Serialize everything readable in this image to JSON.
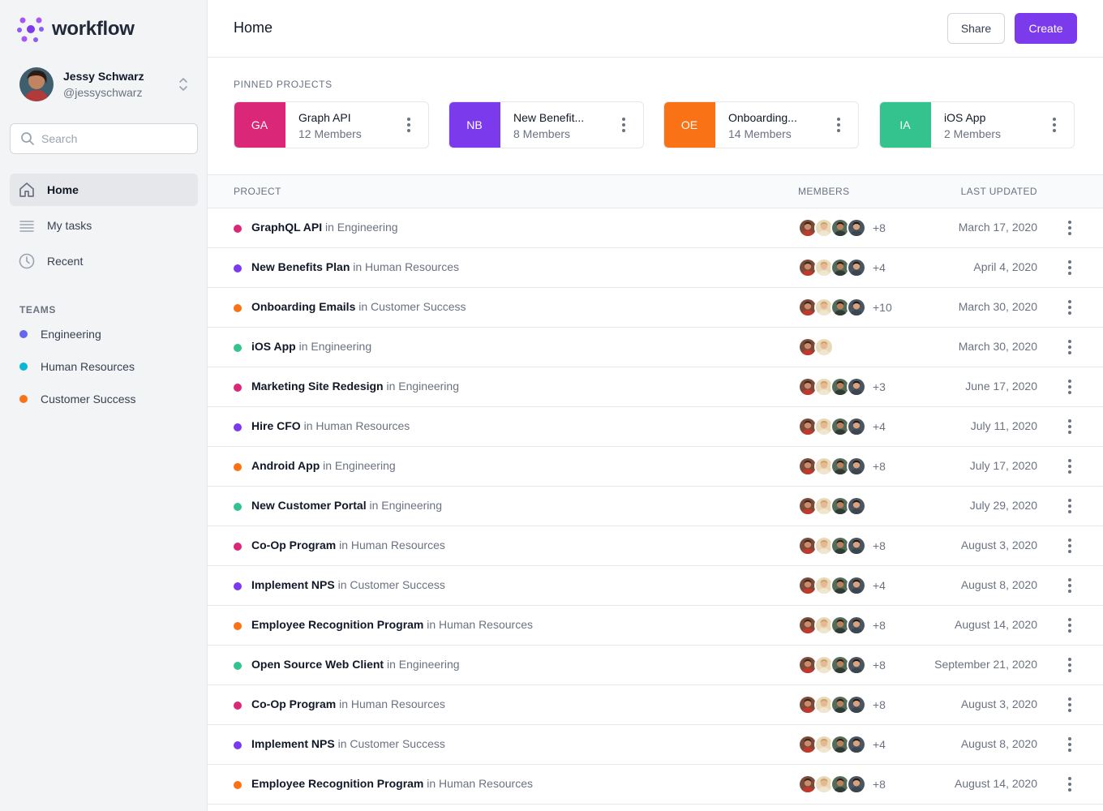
{
  "app": {
    "name": "workflow"
  },
  "user": {
    "name": "Jessy Schwarz",
    "handle": "@jessyschwarz"
  },
  "search": {
    "placeholder": "Search",
    "value": ""
  },
  "nav": [
    {
      "label": "Home",
      "icon": "home-icon",
      "active": true
    },
    {
      "label": "My tasks",
      "icon": "list-icon",
      "active": false
    },
    {
      "label": "Recent",
      "icon": "clock-icon",
      "active": false
    }
  ],
  "teams": {
    "heading": "TEAMS",
    "items": [
      {
        "label": "Engineering",
        "color": "#6366f1"
      },
      {
        "label": "Human Resources",
        "color": "#06b6d4"
      },
      {
        "label": "Customer Success",
        "color": "#f97316"
      }
    ]
  },
  "header": {
    "title": "Home",
    "share_label": "Share",
    "create_label": "Create"
  },
  "pinned": {
    "heading": "PINNED PROJECTS",
    "items": [
      {
        "initials": "GA",
        "name": "Graph API",
        "members": "12 Members",
        "color": "#db2777"
      },
      {
        "initials": "NB",
        "name": "New Benefit...",
        "members": "8 Members",
        "color": "#7c3aed"
      },
      {
        "initials": "OE",
        "name": "Onboarding...",
        "members": "14 Members",
        "color": "#f97316"
      },
      {
        "initials": "IA",
        "name": "iOS App",
        "members": "2 Members",
        "color": "#34c38f"
      }
    ]
  },
  "table": {
    "headers": {
      "project": "PROJECT",
      "members": "MEMBERS",
      "updated": "LAST UPDATED"
    },
    "rows": [
      {
        "name": "GraphQL API",
        "team": "in Engineering",
        "color": "#db2777",
        "avatars": 4,
        "extra": "+8",
        "date": "March 17, 2020"
      },
      {
        "name": "New Benefits Plan",
        "team": "in Human Resources",
        "color": "#7c3aed",
        "avatars": 4,
        "extra": "+4",
        "date": "April 4, 2020"
      },
      {
        "name": "Onboarding Emails",
        "team": "in Customer Success",
        "color": "#f97316",
        "avatars": 4,
        "extra": "+10",
        "date": "March 30, 2020"
      },
      {
        "name": "iOS App",
        "team": "in Engineering",
        "color": "#34c38f",
        "avatars": 2,
        "extra": "",
        "date": "March 30, 2020"
      },
      {
        "name": "Marketing Site Redesign",
        "team": "in Engineering",
        "color": "#db2777",
        "avatars": 4,
        "extra": "+3",
        "date": "June 17, 2020"
      },
      {
        "name": "Hire CFO",
        "team": "in Human Resources",
        "color": "#7c3aed",
        "avatars": 4,
        "extra": "+4",
        "date": "July 11, 2020"
      },
      {
        "name": "Android App",
        "team": "in Engineering",
        "color": "#f97316",
        "avatars": 4,
        "extra": "+8",
        "date": "July 17, 2020"
      },
      {
        "name": "New Customer Portal",
        "team": "in Engineering",
        "color": "#34c38f",
        "avatars": 4,
        "extra": "",
        "date": "July 29, 2020"
      },
      {
        "name": "Co-Op Program",
        "team": "in Human Resources",
        "color": "#db2777",
        "avatars": 4,
        "extra": "+8",
        "date": "August 3, 2020"
      },
      {
        "name": "Implement NPS",
        "team": "in Customer Success",
        "color": "#7c3aed",
        "avatars": 4,
        "extra": "+4",
        "date": "August 8, 2020"
      },
      {
        "name": "Employee Recognition Program",
        "team": "in Human Resources",
        "color": "#f97316",
        "avatars": 4,
        "extra": "+8",
        "date": "August 14, 2020"
      },
      {
        "name": "Open Source Web Client",
        "team": "in Engineering",
        "color": "#34c38f",
        "avatars": 4,
        "extra": "+8",
        "date": "September 21, 2020"
      },
      {
        "name": "Co-Op Program",
        "team": "in Human Resources",
        "color": "#db2777",
        "avatars": 4,
        "extra": "+8",
        "date": "August 3, 2020"
      },
      {
        "name": "Implement NPS",
        "team": "in Customer Success",
        "color": "#7c3aed",
        "avatars": 4,
        "extra": "+4",
        "date": "August 8, 2020"
      },
      {
        "name": "Employee Recognition Program",
        "team": "in Human Resources",
        "color": "#f97316",
        "avatars": 4,
        "extra": "+8",
        "date": "August 14, 2020"
      }
    ]
  }
}
